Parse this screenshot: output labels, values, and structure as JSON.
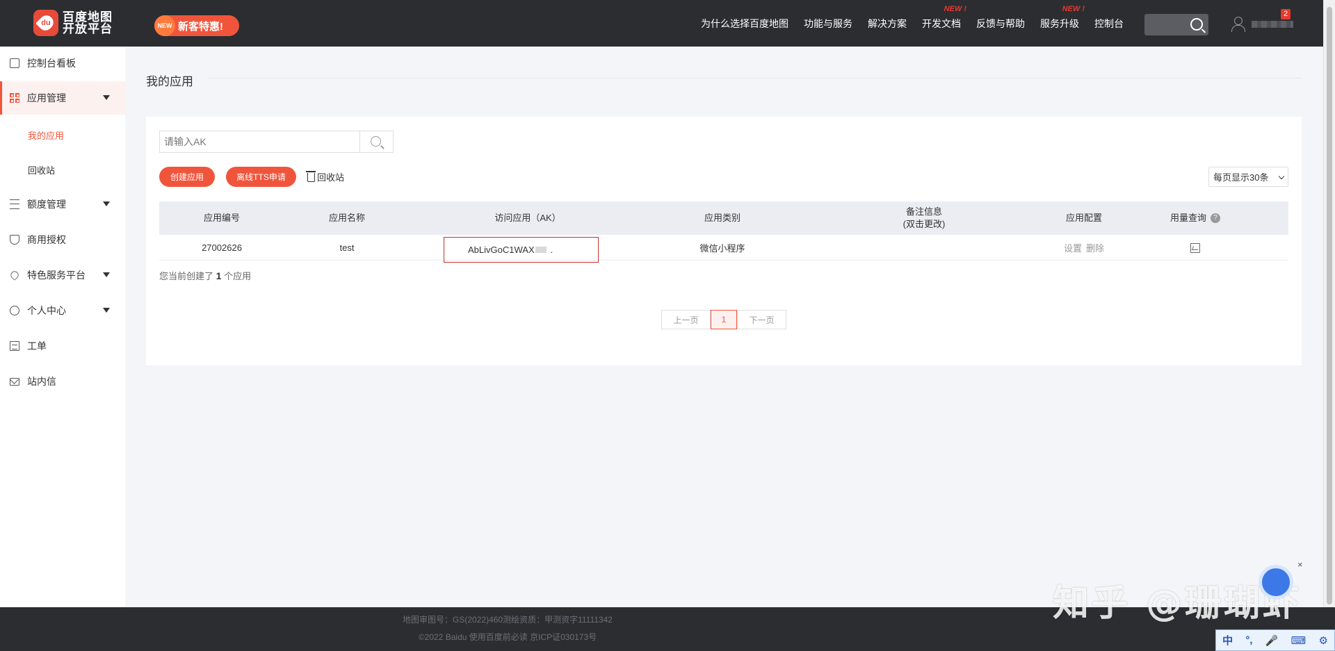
{
  "topbar": {
    "logo_line1": "百度地图",
    "logo_line2": "开放平台",
    "logo_mark": "du",
    "promo_new": "NEW",
    "promo_label": "新客特惠!",
    "nav": [
      {
        "label": "为什么选择百度地图",
        "new": ""
      },
      {
        "label": "功能与服务",
        "new": ""
      },
      {
        "label": "解决方案",
        "new": ""
      },
      {
        "label": "开发文档",
        "new": "NEW !"
      },
      {
        "label": "反馈与帮助",
        "new": ""
      },
      {
        "label": "服务升级",
        "new": "NEW !"
      },
      {
        "label": "控制台",
        "new": ""
      }
    ],
    "notification_count": "2",
    "colors": {
      "bar": "#2b2d31",
      "accent": "#f0553c",
      "new_tag": "#e8392d"
    }
  },
  "sidebar": {
    "items": [
      {
        "label": "控制台看板",
        "icon": "dashboard-icon"
      },
      {
        "label": "应用管理",
        "icon": "grid-icon",
        "expanded": true
      },
      {
        "label": "额度管理",
        "icon": "sliders-icon"
      },
      {
        "label": "商用授权",
        "icon": "shield-icon"
      },
      {
        "label": "特色服务平台",
        "icon": "heart-icon"
      },
      {
        "label": "个人中心",
        "icon": "person-icon"
      },
      {
        "label": "工单",
        "icon": "ticket-icon"
      },
      {
        "label": "站内信",
        "icon": "mail-icon"
      }
    ],
    "subitems": [
      {
        "label": "我的应用",
        "active": true
      },
      {
        "label": "回收站",
        "active": false
      }
    ]
  },
  "main": {
    "title": "我的应用",
    "search_placeholder": "请输入AK",
    "create_button": "创建应用",
    "tts_button": "离线TTS申请",
    "recycle_link": "回收站",
    "page_size": "每页显示30条",
    "table": {
      "headers": [
        "应用编号",
        "应用名称",
        "访问应用（AK）",
        "应用类别",
        "备注信息",
        "(双击更改)",
        "应用配置",
        "用量查询"
      ],
      "rows": [
        {
          "id": "27002626",
          "name": "test",
          "ak": "AbLivGoC1WAX",
          "ak_tail": ".",
          "category": "微信小程序",
          "note": "",
          "actions": [
            "设置",
            "删除"
          ]
        }
      ]
    },
    "summary_prefix": "您当前创建了",
    "summary_count": "1",
    "summary_suffix": "个应用",
    "pager": {
      "prev": "上一页",
      "current": "1",
      "next": "下一页"
    }
  },
  "footer": {
    "line1": "地图审图号：GS(2022)460测绘资质：甲测资字11111342",
    "line2": "©2022 Baidu 使用百度前必读 京ICP证030173号"
  },
  "overlay": {
    "watermark": "知乎 @珊瑚虾",
    "close": "×",
    "ime": [
      "中",
      "°,",
      "🎤",
      "⌨",
      "⚙"
    ]
  }
}
